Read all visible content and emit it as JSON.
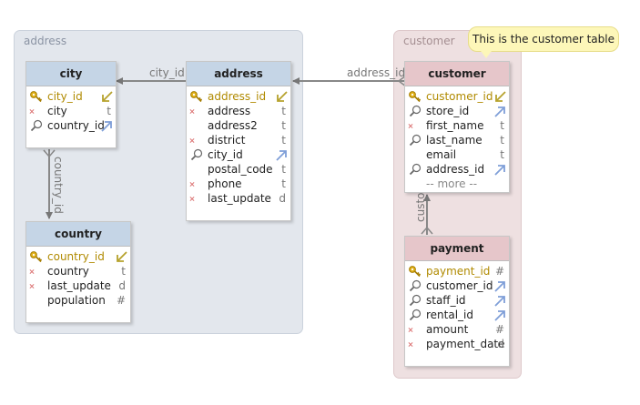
{
  "groups": {
    "address": "address",
    "customer": "customer"
  },
  "note": "This is the customer table",
  "relations": {
    "city_id": "city_id",
    "address_id": "address_id",
    "country_id": "country_id",
    "customer": "customer"
  },
  "tables": {
    "city": {
      "title": "city",
      "columns": [
        {
          "name": "city_id",
          "type": "",
          "key": "pk"
        },
        {
          "name": "city",
          "type": "t",
          "key": "req"
        },
        {
          "name": "country_id",
          "type": "",
          "key": "fk"
        }
      ]
    },
    "address": {
      "title": "address",
      "columns": [
        {
          "name": "address_id",
          "type": "",
          "key": "pk"
        },
        {
          "name": "address",
          "type": "t",
          "key": "req"
        },
        {
          "name": "address2",
          "type": "t",
          "key": ""
        },
        {
          "name": "district",
          "type": "t",
          "key": "req"
        },
        {
          "name": "city_id",
          "type": "",
          "key": "fk"
        },
        {
          "name": "postal_code",
          "type": "t",
          "key": ""
        },
        {
          "name": "phone",
          "type": "t",
          "key": "req"
        },
        {
          "name": "last_update",
          "type": "d",
          "key": "req"
        }
      ]
    },
    "country": {
      "title": "country",
      "columns": [
        {
          "name": "country_id",
          "type": "",
          "key": "pk"
        },
        {
          "name": "country",
          "type": "t",
          "key": "req"
        },
        {
          "name": "last_update",
          "type": "d",
          "key": "req"
        },
        {
          "name": "population",
          "type": "#",
          "key": ""
        }
      ]
    },
    "customer": {
      "title": "customer",
      "columns": [
        {
          "name": "customer_id",
          "type": "",
          "key": "pk"
        },
        {
          "name": "store_id",
          "type": "",
          "key": "fk"
        },
        {
          "name": "first_name",
          "type": "t",
          "key": "req"
        },
        {
          "name": "last_name",
          "type": "t",
          "key": "fkreq"
        },
        {
          "name": "email",
          "type": "t",
          "key": ""
        },
        {
          "name": "address_id",
          "type": "",
          "key": "fk"
        }
      ],
      "more": "-- more --"
    },
    "payment": {
      "title": "payment",
      "columns": [
        {
          "name": "payment_id",
          "type": "#",
          "key": "pk"
        },
        {
          "name": "customer_id",
          "type": "",
          "key": "fk"
        },
        {
          "name": "staff_id",
          "type": "",
          "key": "fk"
        },
        {
          "name": "rental_id",
          "type": "",
          "key": "fkreq"
        },
        {
          "name": "amount",
          "type": "#",
          "key": "req"
        },
        {
          "name": "payment_date",
          "type": "d",
          "key": "req"
        }
      ]
    }
  },
  "colors": {
    "group_address": "#e3e7ed",
    "group_customer": "#eee0e1",
    "header_blue": "#c5d5e6",
    "header_pink": "#e6c6ca",
    "note": "#fdf7b9",
    "pk_text": "#b08a00",
    "fk_arrow": "#7f9fd8"
  },
  "icons": {
    "pk": "key-icon",
    "fk": "magnifier-icon",
    "req": "required-dot-icon",
    "pk_link": "pk-link-arrow-icon",
    "fk_link": "fk-link-arrow-icon"
  }
}
